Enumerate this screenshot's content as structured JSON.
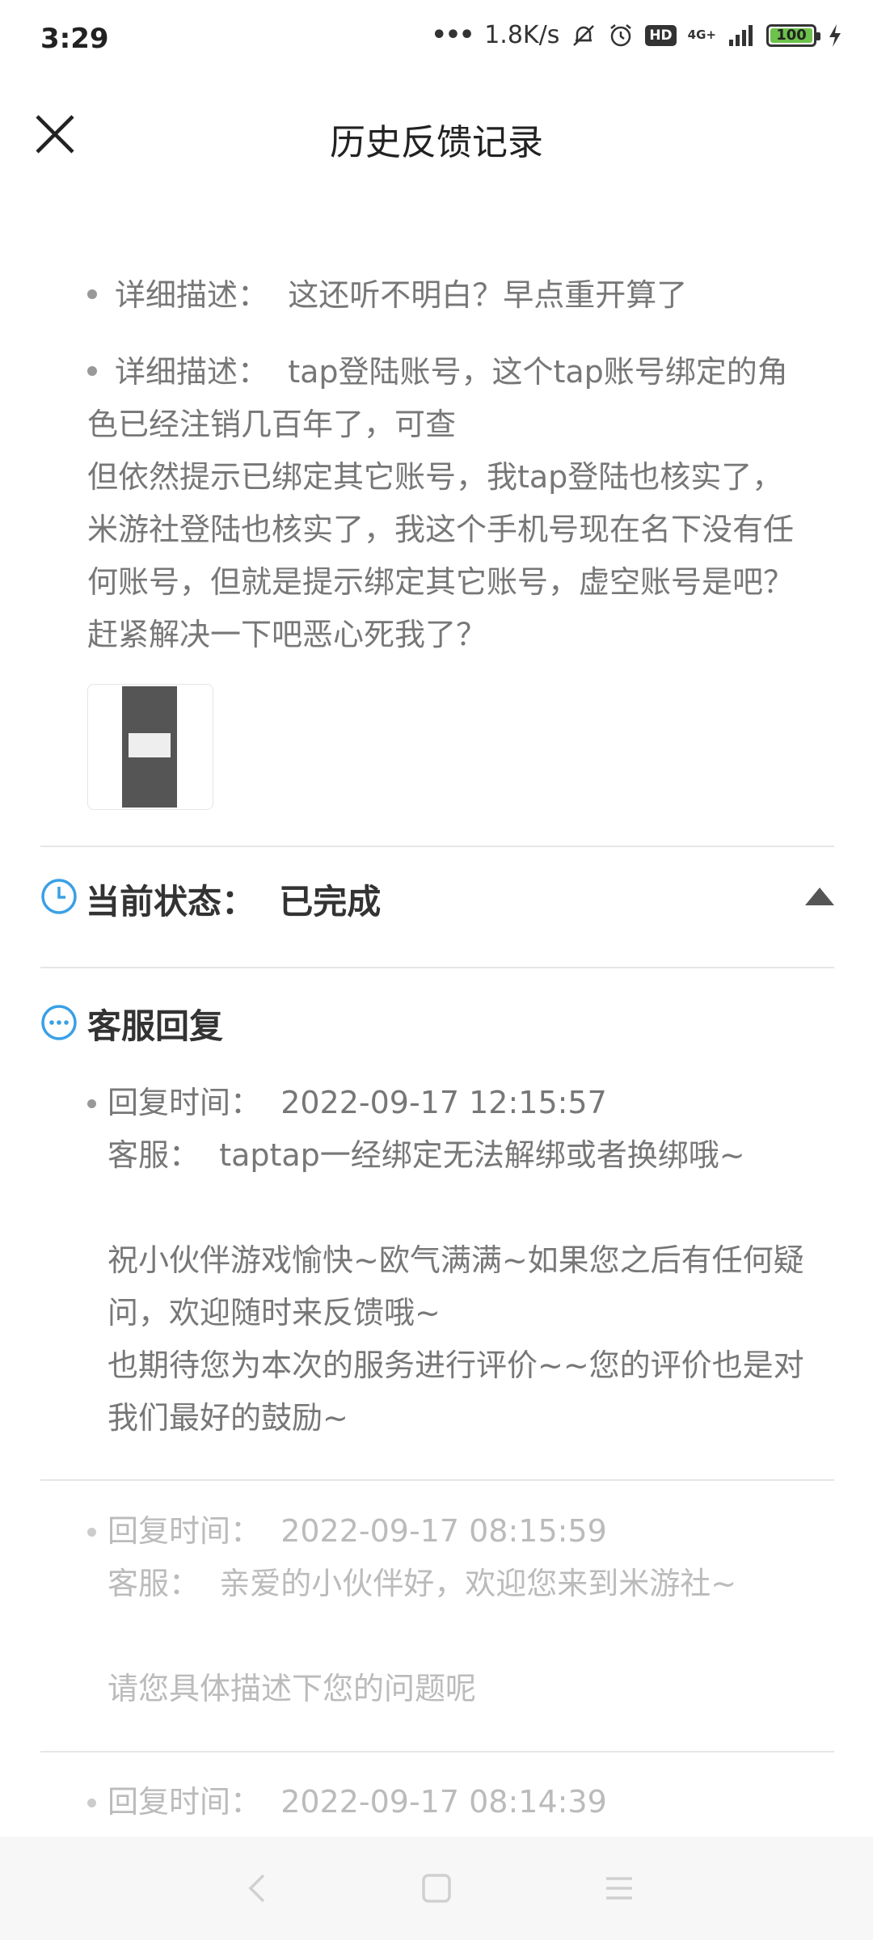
{
  "status_bar": {
    "time": "3:29",
    "dots": "•••",
    "net_speed": "1.8K/s",
    "hd": "HD",
    "network": "4G+",
    "battery": "100",
    "icons": [
      "mute-bell-icon",
      "alarm-icon",
      "signal-icon",
      "charging-icon"
    ]
  },
  "header": {
    "title": "历史反馈记录",
    "close_icon": "close-icon"
  },
  "descriptions": [
    {
      "label": "详细描述：",
      "text": "这还听不明白？早点重开算了"
    },
    {
      "label": "详细描述：",
      "text_line1": "tap登陆账号，这个tap账号绑定的角色已经注销几百年了，可查",
      "text_rest": "但依然提示已绑定其它账号，我tap登陆也核实了，米游社登陆也核实了，我这个手机号现在名下没有任何账号，但就是提示绑定其它账号，虚空账号是吧？赶紧解决一下吧恶心死我了？"
    }
  ],
  "status": {
    "label": "当前状态：",
    "value": "已完成",
    "icon": "clock-icon"
  },
  "replies_section": {
    "title": "客服回复",
    "icon": "chat-bubble-icon",
    "items": [
      {
        "time_label": "回复时间：",
        "time": "2022-09-17 12:15:57",
        "agent_label": "客服：",
        "line1": "taptap一经绑定无法解绑或者换绑哦~",
        "line2": "祝小伙伴游戏愉快~欧气满满~如果您之后有任何疑问，欢迎随时来反馈哦~",
        "line3": "也期待您为本次的服务进行评价~~您的评价也是对我们最好的鼓励~"
      },
      {
        "time_label": "回复时间：",
        "time": "2022-09-17 08:15:59",
        "agent_label": "客服：",
        "line1": "亲爱的小伙伴好，欢迎您来到米游社~",
        "line2": "请您具体描述下您的问题呢"
      },
      {
        "time_label": "回复时间：",
        "time": "2022-09-17 08:14:39"
      }
    ]
  },
  "nav_bar": {
    "buttons": [
      "back-icon",
      "home-icon",
      "menu-icon"
    ]
  }
}
